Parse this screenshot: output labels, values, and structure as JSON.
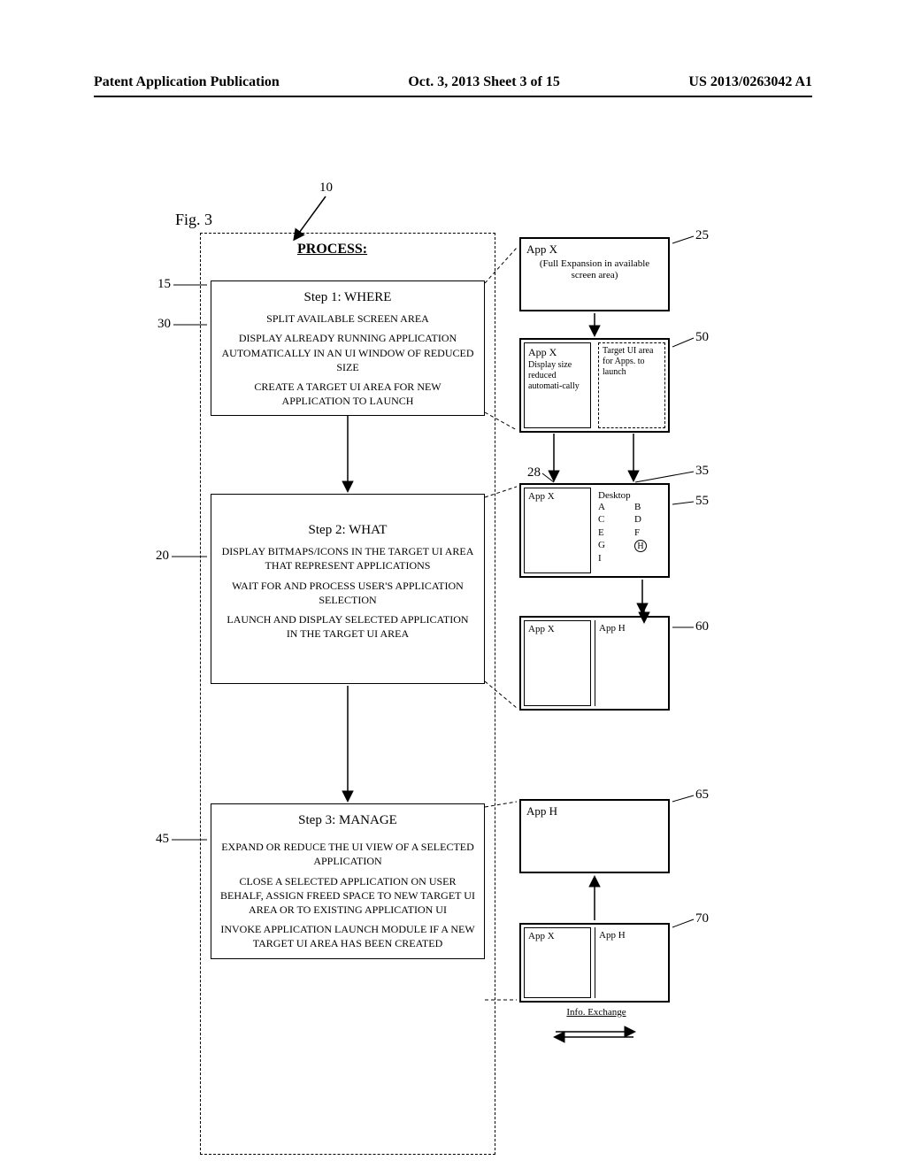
{
  "header": {
    "left": "Patent Application Publication",
    "center": "Oct. 3, 2013   Sheet 3 of 15",
    "right": "US 2013/0263042 A1"
  },
  "figure_label": "Fig. 3",
  "process_title": "PROCESS:",
  "refs": {
    "r10": "10",
    "r15": "15",
    "r20": "20",
    "r25": "25",
    "r28": "28",
    "r30": "30",
    "r35": "35",
    "r45": "45",
    "r50": "50",
    "r55": "55",
    "r60": "60",
    "r65": "65",
    "r70": "70"
  },
  "step1": {
    "title": "Step 1: WHERE",
    "line1": "SPLIT AVAILABLE SCREEN AREA",
    "line2": "DISPLAY ALREADY RUNNING APPLICATION AUTOMATICALLY IN AN UI WINDOW OF REDUCED SIZE",
    "line3": "CREATE A TARGET UI AREA FOR NEW APPLICATION TO LAUNCH"
  },
  "step2": {
    "title": "Step 2: WHAT",
    "line1": "DISPLAY BITMAPS/ICONS IN THE TARGET UI AREA THAT REPRESENT APPLICATIONS",
    "line2": "WAIT FOR AND PROCESS USER'S APPLICATION SELECTION",
    "line3": "LAUNCH AND DISPLAY SELECTED APPLICATION IN THE TARGET UI AREA"
  },
  "step3": {
    "title": "Step 3: MANAGE",
    "line1": "EXPAND OR REDUCE THE UI VIEW OF A SELECTED APPLICATION",
    "line2": "CLOSE A SELECTED APPLICATION ON USER BEHALF, ASSIGN FREED SPACE TO NEW TARGET UI AREA OR TO EXISTING APPLICATION UI",
    "line3": "INVOKE APPLICATION LAUNCH MODULE IF A NEW TARGET UI AREA HAS BEEN CREATED"
  },
  "box25": {
    "title": "App X",
    "sub": "(Full Expansion in available screen area)"
  },
  "box50": {
    "left_title": "App X",
    "left_sub": "Display size reduced automati-cally",
    "right": "Target UI area for Apps. to launch"
  },
  "box55": {
    "left": "App X",
    "right_title": "Desktop",
    "icons": [
      "A",
      "B",
      "C",
      "D",
      "E",
      "F",
      "G",
      "H",
      "I"
    ]
  },
  "box60": {
    "left": "App X",
    "right": "App H"
  },
  "box65": {
    "title": "App H"
  },
  "box70": {
    "left": "App X",
    "right": "App H",
    "exchange": "Info. Exchange"
  }
}
